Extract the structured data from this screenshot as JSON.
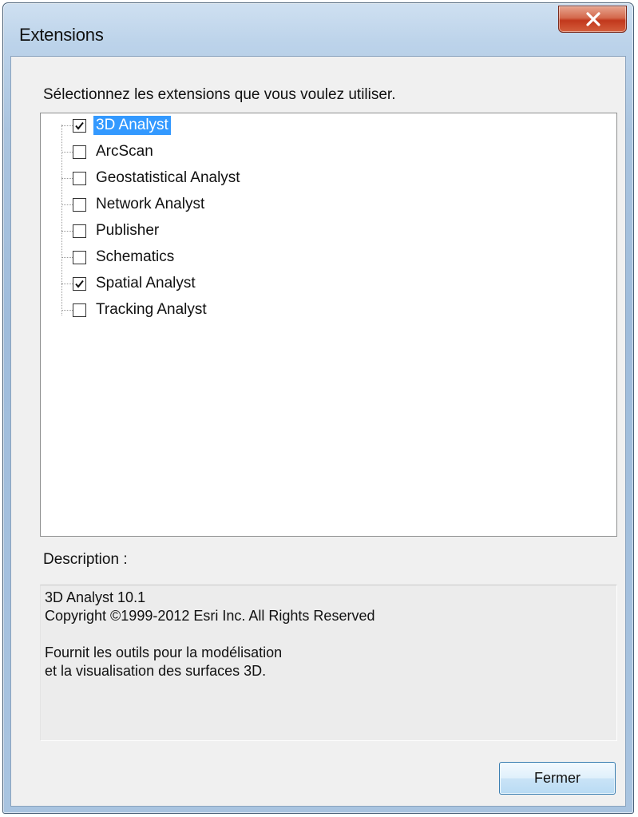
{
  "window": {
    "title": "Extensions",
    "close_icon": "close-icon"
  },
  "prompt": "Sélectionnez les extensions que vous voulez utiliser.",
  "extensions": [
    {
      "label": "3D Analyst",
      "checked": true,
      "selected": true
    },
    {
      "label": "ArcScan",
      "checked": false,
      "selected": false
    },
    {
      "label": "Geostatistical Analyst",
      "checked": false,
      "selected": false
    },
    {
      "label": "Network Analyst",
      "checked": false,
      "selected": false
    },
    {
      "label": "Publisher",
      "checked": false,
      "selected": false
    },
    {
      "label": "Schematics",
      "checked": false,
      "selected": false
    },
    {
      "label": "Spatial Analyst",
      "checked": true,
      "selected": false
    },
    {
      "label": "Tracking Analyst",
      "checked": false,
      "selected": false
    }
  ],
  "description": {
    "label": "Description :",
    "lines": [
      "3D Analyst 10.1",
      "Copyright ©1999-2012 Esri Inc. All Rights Reserved",
      "",
      "Fournit les outils pour la modélisation",
      "et la visualisation des surfaces 3D."
    ]
  },
  "buttons": {
    "close_label": "Fermer"
  },
  "colors": {
    "selection": "#3399ff",
    "title_bar": "#b9d1ea",
    "close_button": "#c7432a"
  }
}
